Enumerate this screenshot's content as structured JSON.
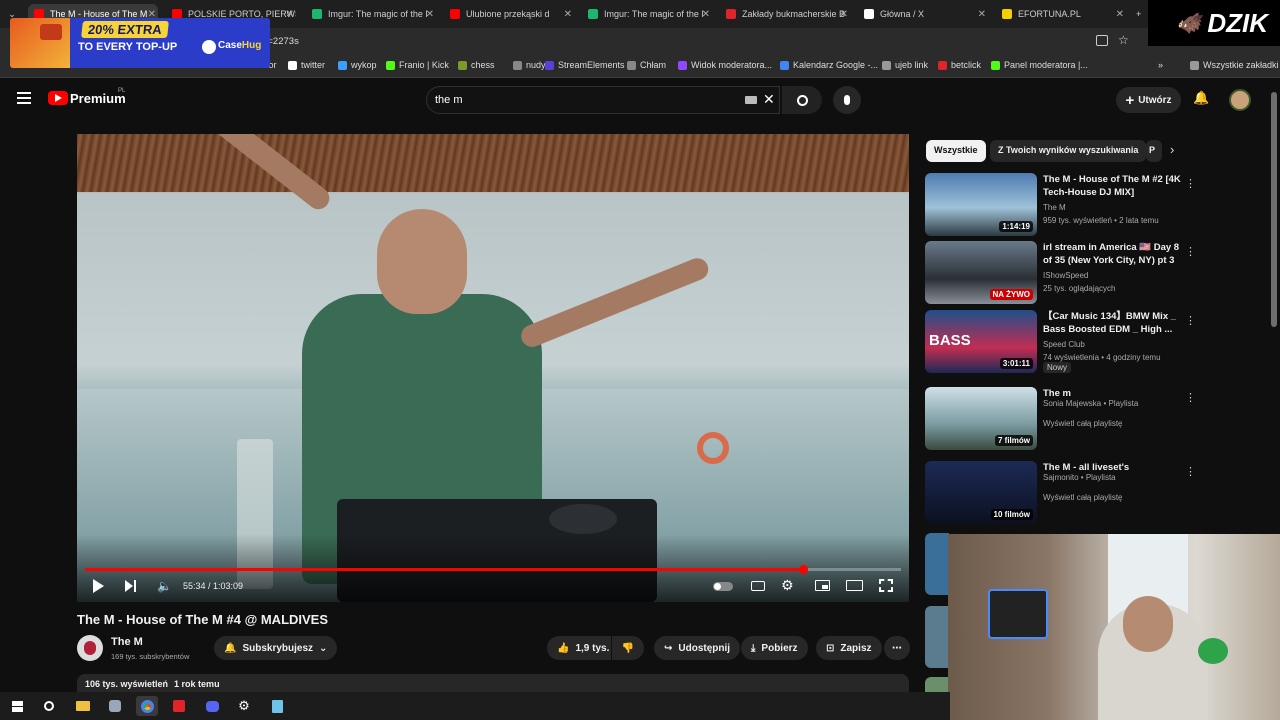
{
  "browser": {
    "tabs": [
      {
        "label": "The M - House of The M",
        "color": "#ff0000"
      },
      {
        "label": "POLSKIE PORTO, PIERWS",
        "color": "#ff0000"
      },
      {
        "label": "Imgur: The magic of the I",
        "color": "#1bb76e"
      },
      {
        "label": "Ulubione przekąski d",
        "color": "#ff0000"
      },
      {
        "label": "Imgur: The magic of the I",
        "color": "#1bb76e"
      },
      {
        "label": "Zakłady bukmacherskie B",
        "color": "#e0242b"
      },
      {
        "label": "Główna / X",
        "color": "#ffffff"
      },
      {
        "label": "EFORTUNA.PL",
        "color": "#f5d000"
      }
    ],
    "address": "kt=2273s",
    "bookmarks": [
      {
        "label": "twitter"
      },
      {
        "label": "wykop"
      },
      {
        "label": "Franio | Kick"
      },
      {
        "label": "chess"
      },
      {
        "label": "nudy"
      },
      {
        "label": "StreamElements"
      },
      {
        "label": "Chłam"
      },
      {
        "label": "Widok moderatora..."
      },
      {
        "label": "Kalendarz Google -..."
      },
      {
        "label": "ujeb link"
      },
      {
        "label": "betclick"
      },
      {
        "label": "Panel moderatora |..."
      },
      {
        "label": "Wszystkie zakładki"
      }
    ],
    "partial_bookmark": "sior"
  },
  "overlay": {
    "banner_line1": "20% EXTRA",
    "banner_line2": "TO EVERY TOP-UP",
    "banner_brand": "Case",
    "banner_brand2": "Hug",
    "dzik": "DZIK"
  },
  "youtube": {
    "logo": "Premium",
    "region": "PL",
    "search_value": "the m",
    "create_label": "Utwórz",
    "video": {
      "time": "55:34 / 1:03:09",
      "progress": 0.88,
      "title": "The M - House of The M #4 @ MALDIVES",
      "channel": "The M",
      "subs": "169 tys. subskrybentów",
      "subscribe_label": "Subskrybujesz",
      "likes": "1,9 tys.",
      "share": "Udostępnij",
      "download": "Pobierz",
      "save": "Zapisz",
      "desc_views": "106 tys. wyświetleń",
      "desc_age": "1 rok temu"
    },
    "chips": [
      "Wszystkie",
      "Z Twoich wyników wyszukiwania",
      "P"
    ],
    "recommendations": [
      {
        "title": "The M - House of The M #2 [4K Tech-House DJ MIX]",
        "channel": "The M",
        "meta": "959 tys. wyświetleń • 2 lata temu",
        "duration": "1:14:19",
        "extra": ""
      },
      {
        "title": "irl stream in America 🇺🇸 Day 8 of 35 (New York City, NY) pt 3",
        "channel": "IShowSpeed",
        "meta": "25 tys. oglądających",
        "duration": "NA ŻYWO",
        "extra": ""
      },
      {
        "title": "【Car Music 134】BMW Mix _ Bass Boosted EDM _ High ...",
        "channel": "Speed Club",
        "meta": "74 wyświetlenia • 4 godziny temu",
        "duration": "3:01:11",
        "extra": "Nowy"
      },
      {
        "title": "The m",
        "channel": "Sonia Majewska • Playlista",
        "meta": "Wyświetl całą playlistę",
        "duration": "7 filmów",
        "extra": ""
      },
      {
        "title": "The M - all liveset's",
        "channel": "Sajmonito • Playlista",
        "meta": "Wyświetl całą playlistę",
        "duration": "10 filmów",
        "extra": ""
      }
    ],
    "thumb_bass": "BASS"
  }
}
